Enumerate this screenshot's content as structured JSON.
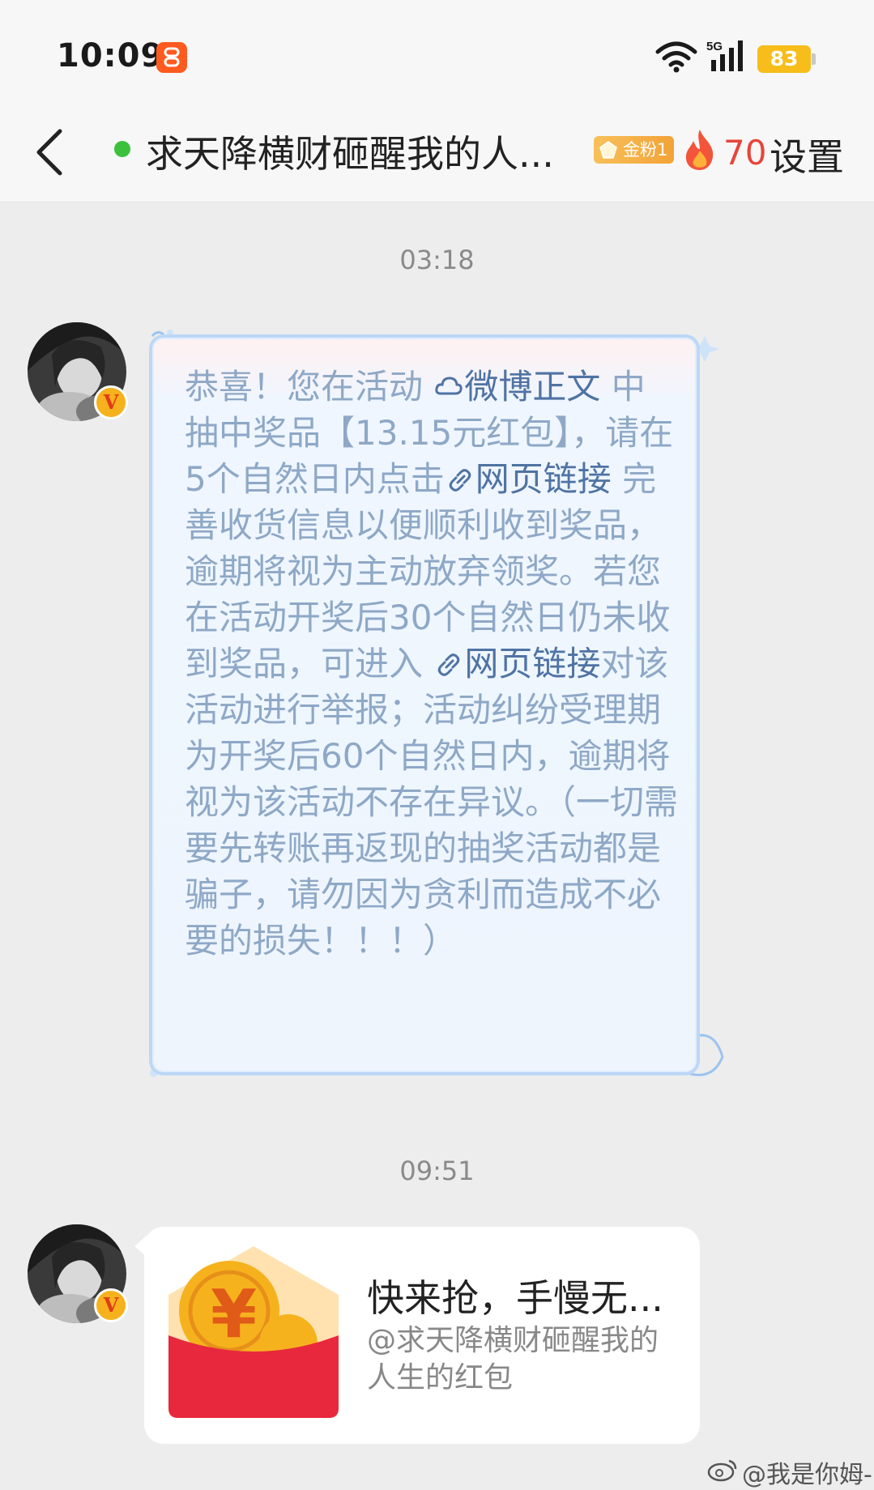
{
  "status_bar": {
    "time": "10:09",
    "network": "5G",
    "battery": "83"
  },
  "nav": {
    "title": "求天降横财砸醒我的人...",
    "fan_badge": "金粉1",
    "fire_count": "70",
    "settings": "设置"
  },
  "messages": [
    {
      "timestamp": "03:18",
      "type": "notice",
      "segments": {
        "part1": "恭喜！您在活动",
        "weibo_link": "微博正文",
        "part2": "中抽中奖品【13.15元红包】，请在5个自然日内点击",
        "link1": "网页链接",
        "part3": "完善收货信息以便顺利收到奖品，逾期将视为主动放弃领奖。若您在活动开奖后30个自然日仍未收到奖品，可进入",
        "link2": "网页链接",
        "part4": "对该活动进行举报；活动纠纷受理期为开奖后60个自然日内，逾期将视为该活动不存在异议。（一切需要先转账再返现的抽奖活动都是骗子，请勿因为贪利而造成不必要的损失！！！）"
      }
    },
    {
      "timestamp": "09:51",
      "type": "red_packet",
      "title": "快来抢，手慢无...",
      "subtitle": "@求天降横财砸醒我的人生的红包"
    }
  ],
  "watermark": "@我是你姆-",
  "colors": {
    "online": "#3cc13c",
    "fire": "#e8443a",
    "link": "#4f73a3",
    "notice_text": "#8ea8c6",
    "red_packet": "#e8283c",
    "coin": "#f6b21d"
  },
  "icons": [
    "back-icon",
    "app-badge-icon",
    "wifi-icon",
    "signal-icon",
    "fire-icon",
    "weibo-icon",
    "link-icon",
    "verify-icon"
  ]
}
